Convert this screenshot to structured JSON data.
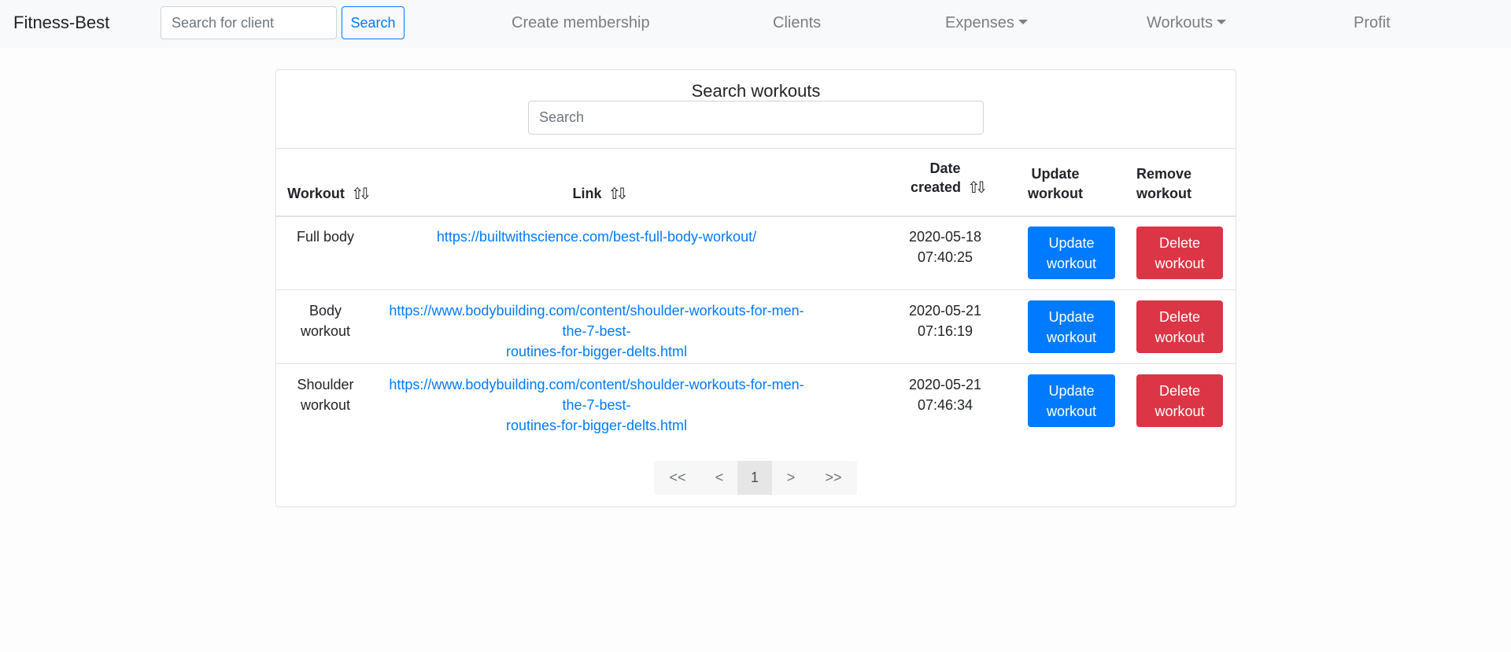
{
  "navbar": {
    "brand": "Fitness-Best",
    "search_placeholder": "Search for client",
    "search_button": "Search",
    "links": {
      "create_membership": "Create membership",
      "clients": "Clients",
      "expenses": "Expenses",
      "workouts": "Workouts",
      "profit": "Profit"
    }
  },
  "card": {
    "title": "Search workouts",
    "search_placeholder": "Search",
    "columns": {
      "workout": "Workout",
      "link": "Link",
      "date_line1": "Date",
      "date_line2": "created",
      "update_line1": "Update",
      "update_line2": "workout",
      "remove_line1": "Remove",
      "remove_line2": "workout"
    },
    "rows": [
      {
        "workout_line1": "Full body",
        "workout_line2": "",
        "link_line1": "https://builtwithscience.com/best-full-body-workout/",
        "link_line2": "",
        "date": "2020-05-18",
        "time": "07:40:25",
        "update_line1": "Update",
        "update_line2": "workout",
        "delete_line1": "Delete",
        "delete_line2": "workout"
      },
      {
        "workout_line1": "Body",
        "workout_line2": "workout",
        "link_line1": "https://www.bodybuilding.com/content/shoulder-workouts-for-men-the-7-best-",
        "link_line2": "routines-for-bigger-delts.html",
        "date": "2020-05-21",
        "time": "07:16:19",
        "update_line1": "Update",
        "update_line2": "workout",
        "delete_line1": "Delete",
        "delete_line2": "workout"
      },
      {
        "workout_line1": "Shoulder",
        "workout_line2": "workout",
        "link_line1": "https://www.bodybuilding.com/content/shoulder-workouts-for-men-the-7-best-",
        "link_line2": "routines-for-bigger-delts.html",
        "date": "2020-05-21",
        "time": "07:46:34",
        "update_line1": "Update",
        "update_line2": "workout",
        "delete_line1": "Delete",
        "delete_line2": "workout"
      }
    ],
    "pagination": {
      "first": "<<",
      "prev": "<",
      "current": "1",
      "next": ">",
      "last": ">>"
    }
  },
  "colors": {
    "primary": "#007bff",
    "danger": "#dc3545",
    "navbar_bg": "#f8f9fa"
  },
  "icons": {
    "sort": "sort-arrows-icon",
    "dropdown": "caret-down-icon"
  }
}
